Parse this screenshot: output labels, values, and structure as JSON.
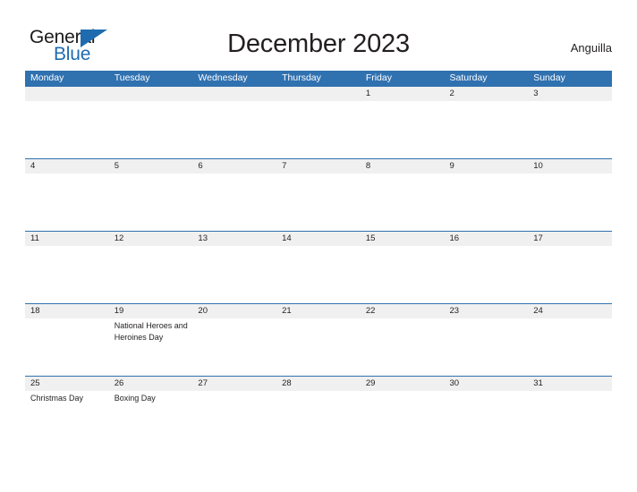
{
  "brand": {
    "name_part1": "General",
    "name_part2": "Blue",
    "triangle_icon": "triangle-logo-icon",
    "color_dark": "#1b1b1b",
    "color_blue": "#1e6bb0"
  },
  "header": {
    "title": "December 2023",
    "country": "Anguilla"
  },
  "colors": {
    "header_blue": "#3071b0",
    "date_band_gray": "#f0f0f0",
    "text": "#231f20"
  },
  "calendar": {
    "weekdays": [
      "Monday",
      "Tuesday",
      "Wednesday",
      "Thursday",
      "Friday",
      "Saturday",
      "Sunday"
    ],
    "weeks": [
      {
        "days": [
          {
            "date": "",
            "event": ""
          },
          {
            "date": "",
            "event": ""
          },
          {
            "date": "",
            "event": ""
          },
          {
            "date": "",
            "event": ""
          },
          {
            "date": "1",
            "event": ""
          },
          {
            "date": "2",
            "event": ""
          },
          {
            "date": "3",
            "event": ""
          }
        ]
      },
      {
        "days": [
          {
            "date": "4",
            "event": ""
          },
          {
            "date": "5",
            "event": ""
          },
          {
            "date": "6",
            "event": ""
          },
          {
            "date": "7",
            "event": ""
          },
          {
            "date": "8",
            "event": ""
          },
          {
            "date": "9",
            "event": ""
          },
          {
            "date": "10",
            "event": ""
          }
        ]
      },
      {
        "days": [
          {
            "date": "11",
            "event": ""
          },
          {
            "date": "12",
            "event": ""
          },
          {
            "date": "13",
            "event": ""
          },
          {
            "date": "14",
            "event": ""
          },
          {
            "date": "15",
            "event": ""
          },
          {
            "date": "16",
            "event": ""
          },
          {
            "date": "17",
            "event": ""
          }
        ]
      },
      {
        "days": [
          {
            "date": "18",
            "event": ""
          },
          {
            "date": "19",
            "event": "National Heroes and Heroines Day"
          },
          {
            "date": "20",
            "event": ""
          },
          {
            "date": "21",
            "event": ""
          },
          {
            "date": "22",
            "event": ""
          },
          {
            "date": "23",
            "event": ""
          },
          {
            "date": "24",
            "event": ""
          }
        ]
      },
      {
        "days": [
          {
            "date": "25",
            "event": "Christmas Day"
          },
          {
            "date": "26",
            "event": "Boxing Day"
          },
          {
            "date": "27",
            "event": ""
          },
          {
            "date": "28",
            "event": ""
          },
          {
            "date": "29",
            "event": ""
          },
          {
            "date": "30",
            "event": ""
          },
          {
            "date": "31",
            "event": ""
          }
        ]
      }
    ]
  }
}
